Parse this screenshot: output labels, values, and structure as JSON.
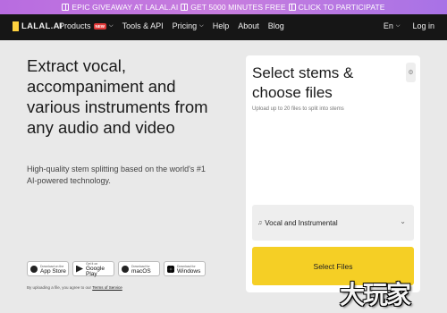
{
  "promo": {
    "segments": [
      "EPIC GIVEAWAY AT LALAL.AI",
      "GET 5000 MINUTES FREE",
      "CLICK TO PARTICIPATE"
    ]
  },
  "nav": {
    "logo": "LALAL.AI",
    "items": [
      {
        "label": "Products",
        "badge": "NEW"
      },
      {
        "label": "Tools & API"
      },
      {
        "label": "Pricing"
      },
      {
        "label": "Help"
      },
      {
        "label": "About"
      },
      {
        "label": "Blog"
      }
    ],
    "language": "En",
    "login": "Log in"
  },
  "hero": {
    "title": "Extract vocal, accompaniment and various instruments from any audio and video",
    "subtitle": "High-quality stem splitting based on the world's #1 AI-powered technology."
  },
  "stores": [
    {
      "small": "Download on the",
      "big": "App Store",
      "icon": "apple-icon"
    },
    {
      "small": "Get it on",
      "big": "Google Play",
      "icon": "google-play-icon"
    },
    {
      "small": "Download for",
      "big": "macOS",
      "icon": "macos-icon"
    },
    {
      "small": "Download for",
      "big": "Windows",
      "icon": "windows-icon"
    }
  ],
  "terms": {
    "prefix": "By uploading a file, you agree to our",
    "link": "Terms of Service"
  },
  "panel": {
    "title": "Select stems & choose files",
    "subtitle": "Upload up to 20 files to split into stems",
    "stem_option": "Vocal and Instrumental",
    "button": "Select Files"
  },
  "watermark": "大玩家"
}
